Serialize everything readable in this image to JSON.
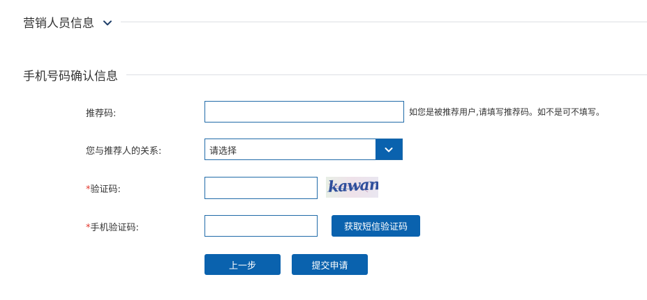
{
  "sections": {
    "marketing": {
      "title": "营销人员信息"
    },
    "phone_confirm": {
      "title": "手机号码确认信息"
    }
  },
  "form": {
    "referral_code": {
      "label": "推荐码:",
      "value": "",
      "hint": "如您是被推荐用户,请填写推荐码。如不是可不填写。"
    },
    "relationship": {
      "label": "您与推荐人的关系:",
      "selected": "请选择"
    },
    "captcha": {
      "required_mark": "*",
      "label": "验证码:",
      "value": "",
      "image_text": "kawan"
    },
    "sms_code": {
      "required_mark": "*",
      "label": "手机验证码:",
      "value": "",
      "get_code_label": "获取短信验证码"
    }
  },
  "actions": {
    "prev_label": "上一步",
    "submit_label": "提交申请"
  },
  "colors": {
    "primary": "#0a62ae",
    "input_border": "#1f6aa8",
    "required": "#e2352b",
    "divider": "#dcdfe3"
  },
  "icons": {
    "section_toggle": "chevron-down-icon",
    "select_toggle": "chevron-down-icon"
  }
}
